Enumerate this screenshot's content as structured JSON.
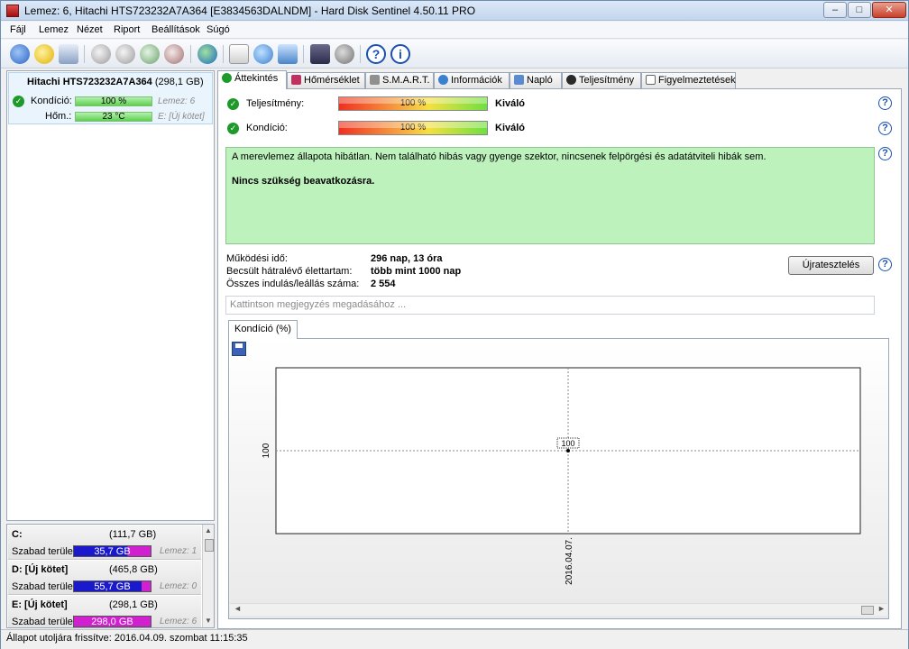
{
  "window": {
    "title": "Lemez: 6, Hitachi HTS723232A7A364 [E3834563DALNDM]  -  Hard Disk Sentinel 4.50.11 PRO"
  },
  "menu": [
    "Fájl",
    "Lemez",
    "Nézet",
    "Riport",
    "Beállítások",
    "Súgó"
  ],
  "toolbar": {
    "icons": [
      "refresh-icon",
      "alert-icon",
      "disk-info-icon",
      "disk-test-icon",
      "disk-scan-icon",
      "disk-repair-icon",
      "disk-erase-icon",
      "globe-icon",
      "report-icon",
      "update-icon",
      "send-icon",
      "monitor-icon",
      "sound-icon",
      "help-icon",
      "info-icon"
    ]
  },
  "left": {
    "disk_name": "Hitachi HTS723232A7A364",
    "disk_size": "(298,1 GB)",
    "kondicio_label": "Kondíció:",
    "kondicio_value": "100 %",
    "lemez": "Lemez: 6",
    "hom_label": "Hőm.:",
    "hom_value": "23 °C",
    "partition": "E: [Új kötet]"
  },
  "volumes": [
    {
      "letter": "C:",
      "size": "(111,7 GB)",
      "free_label": "Szabad terület",
      "free": "35,7 GB",
      "note": "Lemez: 1",
      "color": "#1a1acc"
    },
    {
      "letter": "D: [Új kötet]",
      "size": "(465,8 GB)",
      "free_label": "Szabad terület",
      "free": "55,7 GB",
      "note": "Lemez: 0",
      "color": "#1a1acc"
    },
    {
      "letter": "E: [Új kötet]",
      "size": "(298,1 GB)",
      "free_label": "Szabad terület",
      "free": "298,0 GB",
      "note": "Lemez: 6",
      "color": "#d020d0"
    }
  ],
  "tabs": [
    "Áttekintés",
    "Hőmérséklet",
    "S.M.A.R.T.",
    "Információk",
    "Napló",
    "Teljesítmény",
    "Figyelmeztetések"
  ],
  "overview": {
    "performance_label": "Teljesítmény:",
    "performance_value": "100 %",
    "performance_rating": "Kiváló",
    "condition_label": "Kondíció:",
    "condition_value": "100 %",
    "condition_rating": "Kiváló",
    "status_text": "A merevlemez állapota hibátlan. Nem található hibás vagy gyenge szektor, nincsenek felpörgési és adatátviteli hibák sem.",
    "status_action": "Nincs szükség beavatkozásra.",
    "uptime_label": "Működési idő:",
    "uptime_value": "296 nap, 13 óra",
    "lifetime_label": "Becsült hátralévő élettartam:",
    "lifetime_value": "több mint 1000 nap",
    "startstop_label": "Összes indulás/leállás száma:",
    "startstop_value": "2 554",
    "retest_button": "Újratesztelés",
    "note_placeholder": "Kattintson megjegyzés megadásához ...",
    "chart_tab": "Kondíció  (%)"
  },
  "chart_data": {
    "type": "line",
    "x": [
      "2016.04.07."
    ],
    "series": [
      {
        "values": [
          100
        ]
      }
    ],
    "ylabel_tick": "100",
    "data_label": "100",
    "grid": true
  },
  "status": "Állapot utoljára frissítve: 2016.04.09. szombat 11:15:35"
}
